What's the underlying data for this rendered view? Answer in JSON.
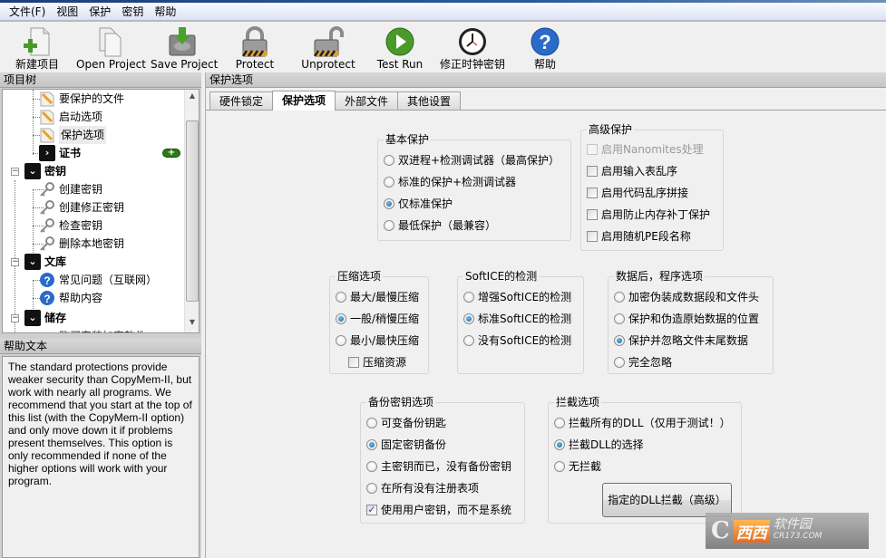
{
  "menubar": [
    "文件(F)",
    "视图",
    "保护",
    "密钥",
    "帮助"
  ],
  "toolbar": [
    {
      "label": "新建项目",
      "icon": "new-project-icon"
    },
    {
      "label": "Open Project",
      "icon": "open-project-icon"
    },
    {
      "label": "Save Project",
      "icon": "save-project-icon"
    },
    {
      "label": "Protect",
      "icon": "lock-icon"
    },
    {
      "label": "Unprotect",
      "icon": "unlock-icon"
    },
    {
      "label": "Test Run",
      "icon": "play-icon"
    },
    {
      "label": "修正时钟密钥",
      "icon": "clock-icon"
    },
    {
      "label": "帮助",
      "icon": "help-icon"
    }
  ],
  "project_tree": {
    "title": "项目树",
    "items": [
      {
        "label": "要保护的文件",
        "icon": "pencil-document-icon"
      },
      {
        "label": "启动选项",
        "icon": "pencil-document-icon"
      },
      {
        "label": "保护选项",
        "icon": "pencil-document-icon",
        "selected": true
      },
      {
        "label": "证书",
        "icon": "chevron-right-icon",
        "badge": "+"
      },
      {
        "label": "密钥",
        "icon": "chevron-down-icon"
      },
      {
        "label": "创建密钥",
        "icon": "key-icon"
      },
      {
        "label": "创建修正密钥",
        "icon": "key-icon"
      },
      {
        "label": "检查密钥",
        "icon": "key-icon"
      },
      {
        "label": "删除本地密钥",
        "icon": "key-icon"
      },
      {
        "label": "文库",
        "icon": "chevron-down-icon"
      },
      {
        "label": "常见问题（互联网）",
        "icon": "help-icon"
      },
      {
        "label": "帮助内容",
        "icon": "help-icon"
      },
      {
        "label": "储存",
        "icon": "chevron-down-icon"
      },
      {
        "label": "购买安装加密软件",
        "icon": "key-icon"
      }
    ]
  },
  "help_text": {
    "title": "帮助文本",
    "body": "The standard protections provide weaker security than CopyMem-II, but work with nearly all programs. We recommend that you start at the top of this list (with the CopyMem-II option) and only move down it if problems present themselves. This option is only recommended if none of the higher options will work with your program."
  },
  "main": {
    "title": "保护选项",
    "tabs": [
      "硬件锁定",
      "保护选项",
      "外部文件",
      "其他设置"
    ],
    "active_tab": "保护选项",
    "basic_protection": {
      "title": "基本保护",
      "options": [
        "双进程+检测调试器（最高保护）",
        "标准的保护+检测调试器",
        "仅标准保护",
        "最低保护（最兼容）"
      ],
      "selected": "仅标准保护"
    },
    "advanced_protection": {
      "title": "高级保护",
      "options": [
        {
          "label": "启用Nanomites处理",
          "checked": false,
          "disabled": true
        },
        {
          "label": "启用输入表乱序",
          "checked": false
        },
        {
          "label": "启用代码乱序拼接",
          "checked": false
        },
        {
          "label": "启用防止内存补丁保护",
          "checked": false
        },
        {
          "label": "启用随机PE段名称",
          "checked": false
        }
      ]
    },
    "compression": {
      "title": "压缩选项",
      "options": [
        "最大/最慢压缩",
        "一般/稍慢压缩",
        "最小/最快压缩"
      ],
      "selected": "一般/稍慢压缩",
      "compress_resources": {
        "label": "压缩资源",
        "checked": false
      }
    },
    "softice": {
      "title": "SoftICE的检测",
      "options": [
        "增强SoftICE的检测",
        "标准SoftICE的检测",
        "没有SoftICE的检测"
      ],
      "selected": "标准SoftICE的检测"
    },
    "overlay": {
      "title": "数据后，程序选项",
      "options": [
        "加密伪装成数据段和文件头",
        "保护和伪造原始数据的位置",
        "保护并忽略文件末尾数据",
        "完全忽略"
      ],
      "selected": "保护并忽略文件末尾数据"
    },
    "backup_key": {
      "title": "备份密钥选项",
      "options": [
        "可变备份钥匙",
        "固定密钥备份",
        "主密钥而已，没有备份密钥",
        "在所有没有注册表项"
      ],
      "selected": "固定密钥备份",
      "use_user_key": {
        "label": "使用用户密钥，而不是系统",
        "checked": true
      }
    },
    "intercept": {
      "title": "拦截选项",
      "options": [
        "拦截所有的DLL（仅用于测试！）",
        "拦截DLL的选择",
        "无拦截"
      ],
      "selected": "拦截DLL的选择",
      "button": "指定的DLL拦截（高级）"
    }
  },
  "watermark": {
    "brand": "西西",
    "text": "软件园",
    "url": "CR173.COM"
  }
}
